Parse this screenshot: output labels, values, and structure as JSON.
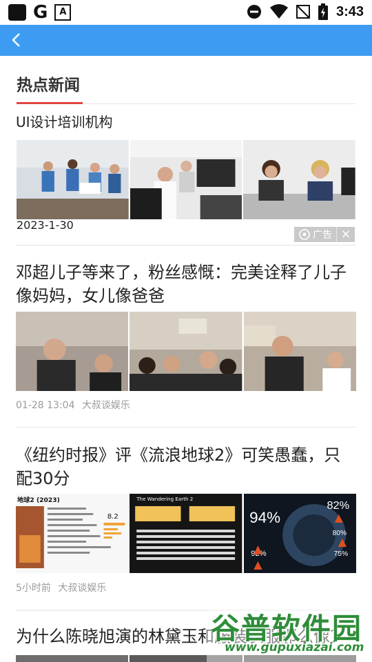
{
  "status_bar": {
    "time": "3:43",
    "g_label": "G",
    "a_label": "A"
  },
  "section": {
    "title": "热点新闻"
  },
  "ad": {
    "title": "UI设计培训机构",
    "date": "2023-1-30",
    "tag": "广告",
    "close": "×"
  },
  "articles": [
    {
      "title": "邓超儿子等来了，粉丝感慨：完美诠释了儿子像妈妈，女儿像爸爸",
      "time": "01-28 13:04",
      "source": "大叔谈娱乐"
    },
    {
      "title": "《纽约时报》评《流浪地球2》可笑愚蠢，只配30分",
      "time": "5小时前",
      "source": "大叔谈娱乐"
    },
    {
      "title": "为什么陈晓旭演的林黛玉和服装衣服那么像？"
    }
  ],
  "poster": {
    "movie_title": "地球2 (2023)",
    "score": "8.2",
    "poster_caption": "The Wandering Earth 2",
    "big_pct": "94%",
    "small_pct": "92%",
    "right_pct_top": "82%",
    "right_pct_mid": "80%",
    "right_pct_bot": "75%"
  },
  "watermark": {
    "cn": "谷普软件园",
    "url": "www.gupuxiazai.com"
  }
}
